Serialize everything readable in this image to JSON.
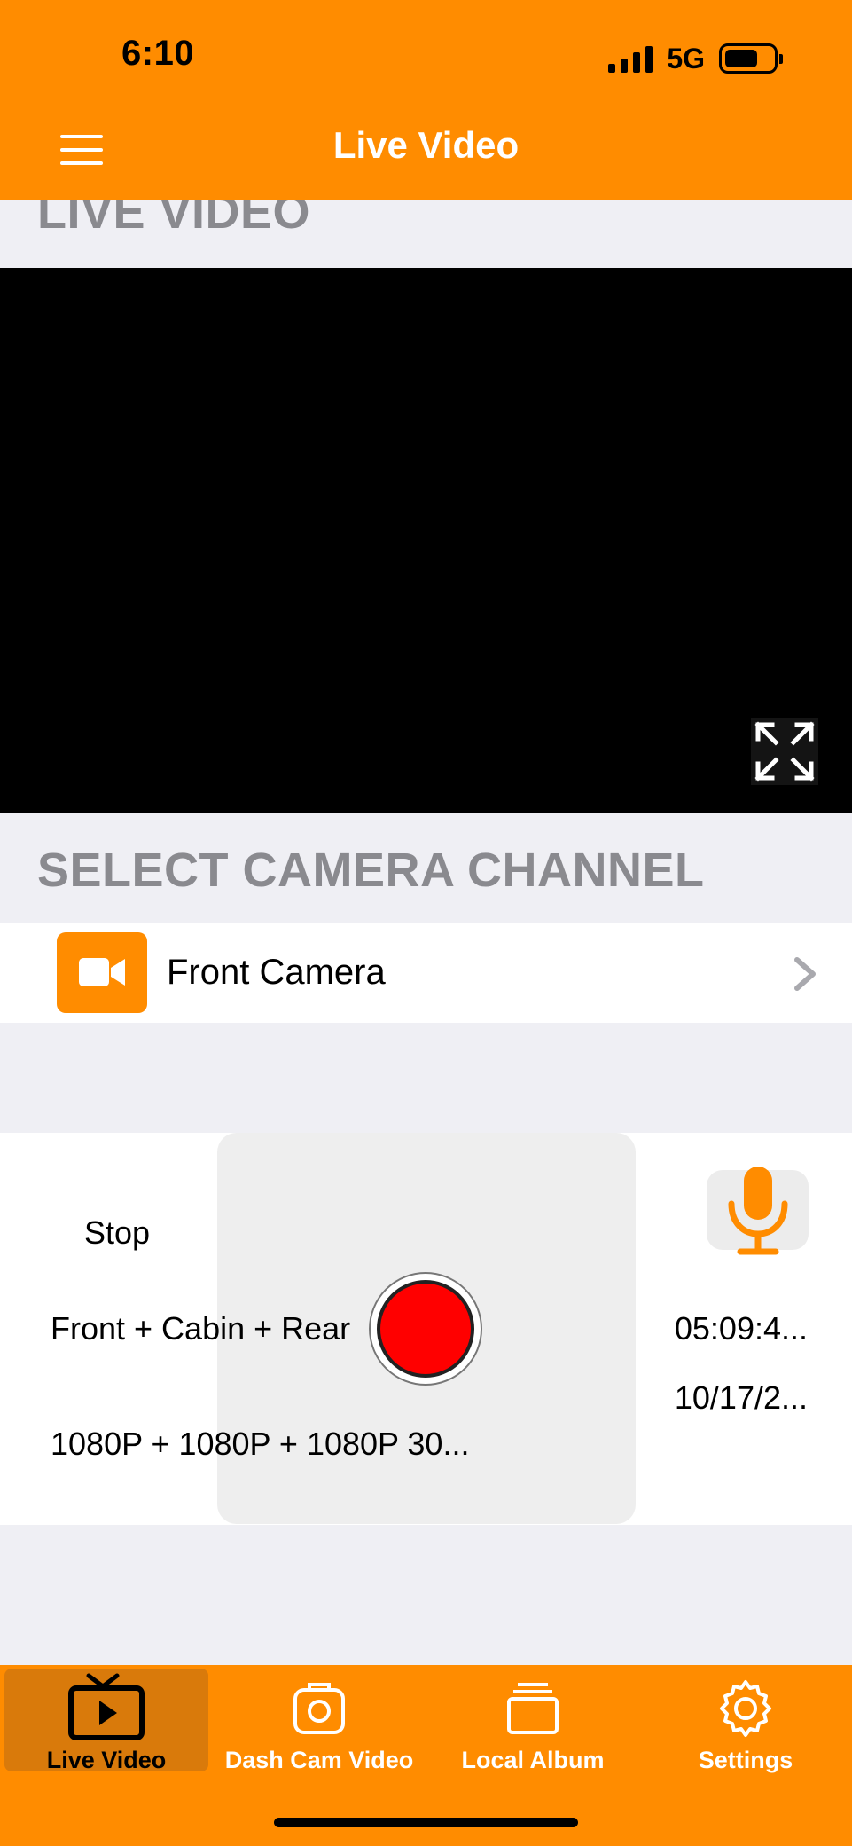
{
  "status_bar": {
    "time": "6:10",
    "network": "5G"
  },
  "nav": {
    "title": "Live Video"
  },
  "live_section": {
    "header": "LIVE VIDEO"
  },
  "camera_section": {
    "header": "SELECT CAMERA CHANNEL",
    "channel_label": "Front Camera"
  },
  "controls": {
    "stop_label": "Stop",
    "channels_label": "Front + Cabin + Rear",
    "resolution_label": "1080P + 1080P + 1080P 30...",
    "time_label": "05:09:4...",
    "date_label": "10/17/2..."
  },
  "tabs": [
    {
      "label": "Live Video",
      "icon": "tv-play-icon",
      "active": true
    },
    {
      "label": "Dash Cam Video",
      "icon": "camera-icon",
      "active": false
    },
    {
      "label": "Local Album",
      "icon": "album-icon",
      "active": false
    },
    {
      "label": "Settings",
      "icon": "gear-icon",
      "active": false
    }
  ],
  "colors": {
    "accent": "#ff8c00",
    "record": "#ff0000",
    "section_text": "#8a8a8f"
  }
}
